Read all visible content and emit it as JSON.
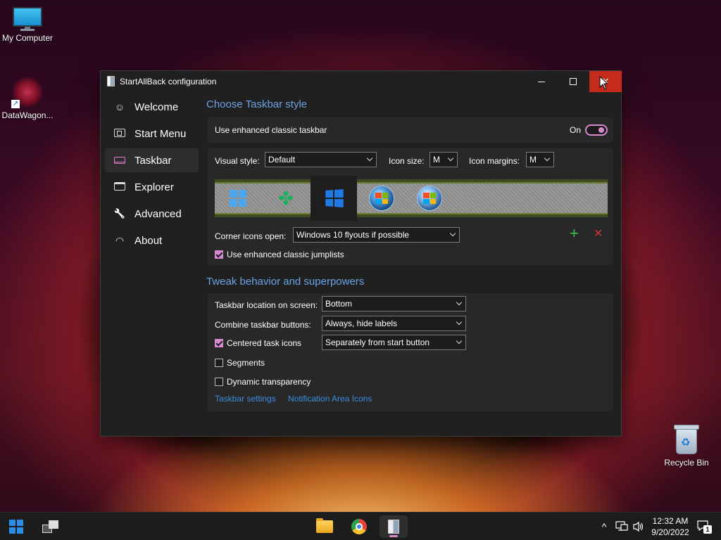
{
  "desktop": {
    "icons": [
      {
        "label": "My Computer",
        "icon": "computer-icon"
      },
      {
        "label": "DataWagon...",
        "icon": "datawagon-shortcut-icon"
      },
      {
        "label": "Recycle Bin",
        "icon": "recycle-bin-icon"
      }
    ]
  },
  "window": {
    "title": "StartAllBack configuration",
    "close_glyph": "✕"
  },
  "sidebar": {
    "items": [
      {
        "label": "Welcome",
        "icon": "smile-icon",
        "glyph": "☺"
      },
      {
        "label": "Start Menu",
        "icon": "start-menu-icon"
      },
      {
        "label": "Taskbar",
        "icon": "taskbar-icon"
      },
      {
        "label": "Explorer",
        "icon": "explorer-icon"
      },
      {
        "label": "Advanced",
        "icon": "wrench-icon",
        "glyph": "🔧"
      },
      {
        "label": "About",
        "icon": "gauge-icon",
        "glyph": "◠"
      }
    ],
    "active": "Taskbar"
  },
  "taskbar_style": {
    "heading": "Choose Taskbar style",
    "enhanced_label": "Use enhanced classic taskbar",
    "enhanced_state": "On",
    "visual_style_label": "Visual style:",
    "visual_style_value": "Default",
    "icon_size_label": "Icon size:",
    "icon_size_value": "M",
    "icon_margins_label": "Icon margins:",
    "icon_margins_value": "M",
    "corner_icons_label": "Corner icons open:",
    "corner_icons_value": "Windows 10 flyouts if possible",
    "add_glyph": "+",
    "remove_glyph": "✕",
    "jumplists_label": "Use enhanced classic jumplists",
    "jumplists_checked": true
  },
  "tweak": {
    "heading": "Tweak behavior and superpowers",
    "location_label": "Taskbar location on screen:",
    "location_value": "Bottom",
    "combine_label": "Combine taskbar buttons:",
    "combine_value": "Always, hide labels",
    "centered_label": "Centered task icons",
    "centered_checked": true,
    "centered_value": "Separately from start button",
    "segments_label": "Segments",
    "segments_checked": false,
    "dynamic_label": "Dynamic transparency",
    "dynamic_checked": false,
    "link_taskbar_settings": "Taskbar settings",
    "link_notification_icons": "Notification Area Icons"
  },
  "taskbar": {
    "pinned": [
      "start-icon",
      "task-view-icon",
      "file-explorer-icon",
      "chrome-icon",
      "startallback-icon"
    ],
    "active_app": "startallback-icon",
    "tray_chevron": "^",
    "time": "12:32 AM",
    "date": "9/20/2022",
    "notification_count": "1"
  },
  "colors": {
    "accent": "#d889d0",
    "link": "#3b8de0",
    "heading": "#6ba3e4",
    "close_hover": "#c42b1c",
    "add": "#3fbf4f",
    "remove": "#c8343a"
  }
}
